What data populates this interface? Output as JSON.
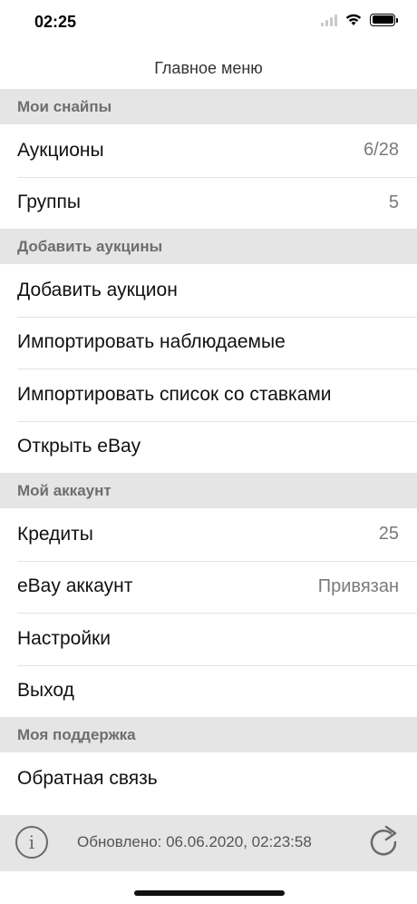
{
  "status_bar": {
    "time": "02:25"
  },
  "nav": {
    "title": "Главное меню"
  },
  "sections": {
    "snipes": {
      "header": "Мои снайпы",
      "auctions": {
        "label": "Аукционы",
        "value": "6/28"
      },
      "groups": {
        "label": "Группы",
        "value": "5"
      }
    },
    "add": {
      "header": "Добавить аукцины",
      "add_auction": {
        "label": "Добавить аукцион"
      },
      "import_watched": {
        "label": "Импортировать наблюдаемые"
      },
      "import_bids": {
        "label": "Импортировать список со ставками"
      },
      "open_ebay": {
        "label": "Открыть eBay"
      }
    },
    "account": {
      "header": "Мой аккаунт",
      "credits": {
        "label": "Кредиты",
        "value": "25"
      },
      "ebay_account": {
        "label": "eBay аккаунт",
        "value": "Привязан"
      },
      "settings": {
        "label": "Настройки"
      },
      "logout": {
        "label": "Выход"
      }
    },
    "support": {
      "header": "Моя поддержка",
      "feedback": {
        "label": "Обратная связь"
      }
    }
  },
  "toolbar": {
    "info_icon": "info-icon",
    "info_glyph": "i",
    "updated": "Обновлено:  06.06.2020, 02:23:58",
    "refresh_icon": "refresh-icon"
  },
  "colors": {
    "section_bg": "#e5e5e5",
    "section_text": "#6e6e6e",
    "value_text": "#7a7a7a"
  }
}
